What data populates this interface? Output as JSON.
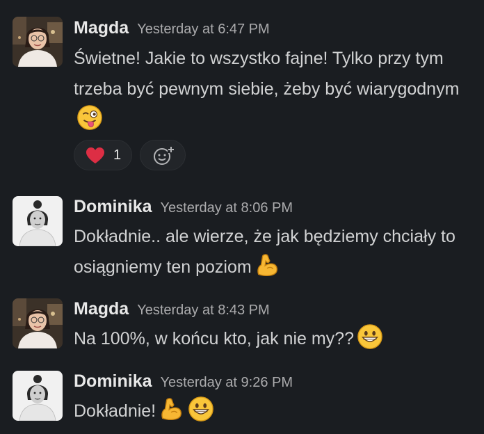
{
  "messages": [
    {
      "author": "Magda",
      "time": "Yesterday at 6:47 PM",
      "text": "Świetne! Jakie to wszystko fajne! Tylko przy tym trzeba być pewnym siebie, żeby być wiarygodnym",
      "emojis": [
        "winking-tongue-emoji"
      ],
      "reactions": [
        {
          "icon": "heart-icon",
          "count": "1"
        }
      ]
    },
    {
      "author": "Dominika",
      "time": "Yesterday at 8:06 PM",
      "text": "Dokładnie.. ale wierze, że jak będziemy chciały to osiągniemy ten poziom",
      "emojis": [
        "flexed-biceps-emoji"
      ]
    },
    {
      "author": "Magda",
      "time": "Yesterday at 8:43 PM",
      "text": "Na 100%, w końcu kto, jak nie my??",
      "emojis": [
        "grinning-emoji"
      ]
    },
    {
      "author": "Dominika",
      "time": "Yesterday at 9:26 PM",
      "text": "Dokładnie!",
      "emojis": [
        "flexed-biceps-emoji",
        "grinning-emoji"
      ]
    }
  ],
  "colors": {
    "background": "#1a1d21",
    "text": "#d1d2d3",
    "timestamp": "#ababad",
    "reaction_bg": "#222529"
  }
}
